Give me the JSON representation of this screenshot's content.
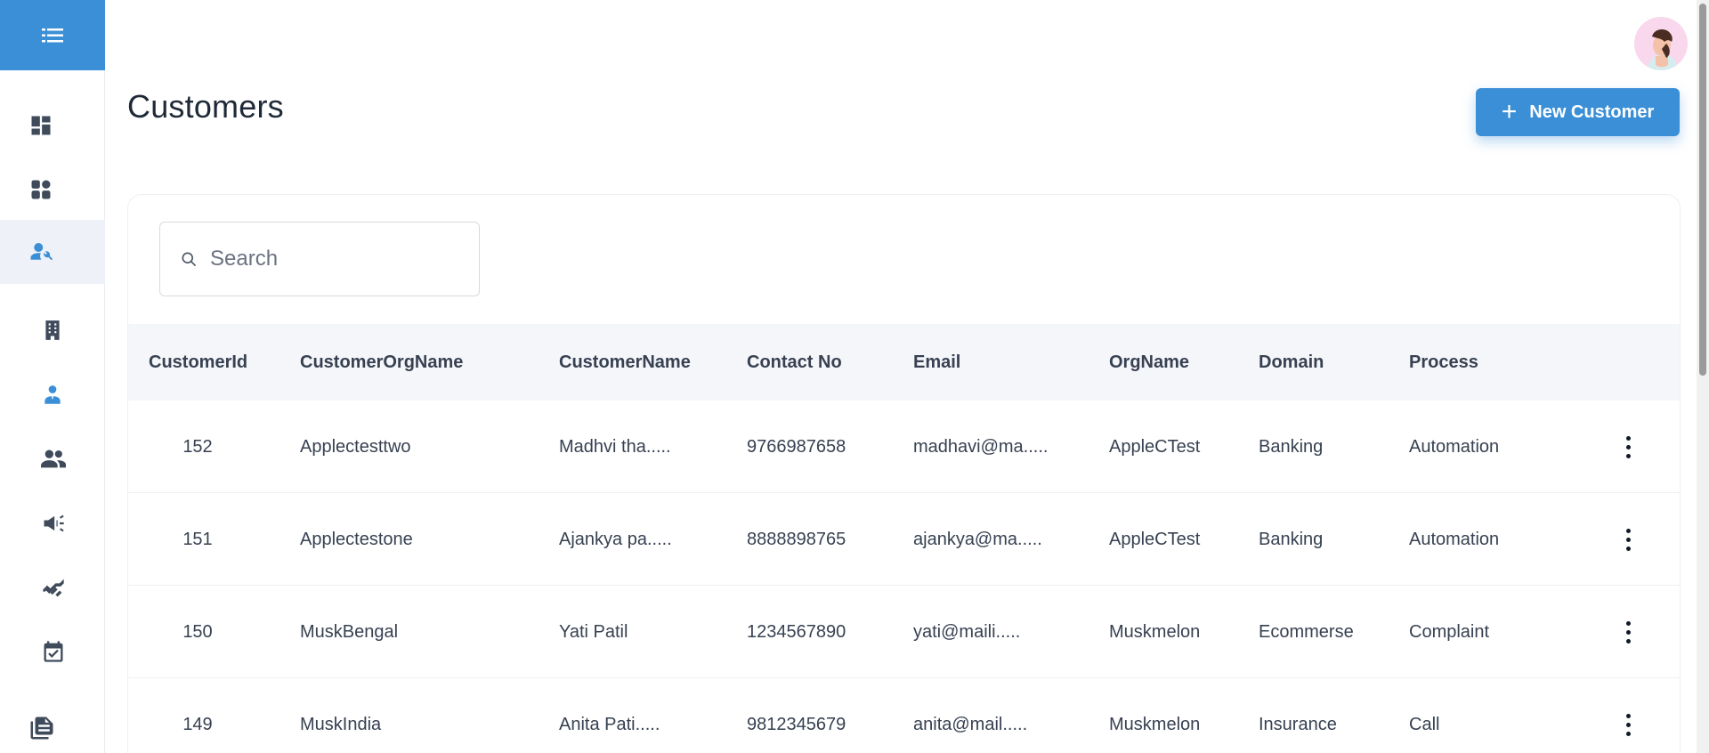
{
  "page": {
    "title": "Customers"
  },
  "header": {
    "new_button_label": "New Customer"
  },
  "search": {
    "placeholder": "Search"
  },
  "sidebar": {
    "items": [
      {
        "icon": "dashboard-icon"
      },
      {
        "icon": "apps-grid-icon"
      },
      {
        "icon": "user-settings-icon",
        "active": true
      },
      {
        "icon": "building-icon"
      },
      {
        "icon": "agent-icon"
      },
      {
        "icon": "users-group-icon"
      },
      {
        "icon": "campaign-icon"
      },
      {
        "icon": "handshake-icon"
      },
      {
        "icon": "calendar-check-icon"
      },
      {
        "icon": "documents-icon"
      }
    ]
  },
  "table": {
    "headers": [
      "CustomerId",
      "CustomerOrgName",
      "CustomerName",
      "Contact No",
      "Email",
      "OrgName",
      "Domain",
      "Process"
    ],
    "rows": [
      [
        "152",
        "Applectesttwo",
        "Madhvi tha.....",
        "9766987658",
        "madhavi@ma.....",
        "AppleCTest",
        "Banking",
        "Automation"
      ],
      [
        "151",
        "Applectestone",
        "Ajankya pa.....",
        "8888898765",
        "ajankya@ma.....",
        "AppleCTest",
        "Banking",
        "Automation"
      ],
      [
        "150",
        "MuskBengal",
        "Yati Patil",
        "1234567890",
        "yati@maili.....",
        "Muskmelon",
        "Ecommerse",
        "Complaint"
      ],
      [
        "149",
        "MuskIndia",
        "Anita Pati.....",
        "9812345679",
        "anita@mail.....",
        "Muskmelon",
        "Insurance",
        "Call"
      ]
    ]
  },
  "colors": {
    "accent": "#3b8fd6",
    "header_bg": "#f5f6fa",
    "active_nav_bg": "#eef2f8"
  }
}
